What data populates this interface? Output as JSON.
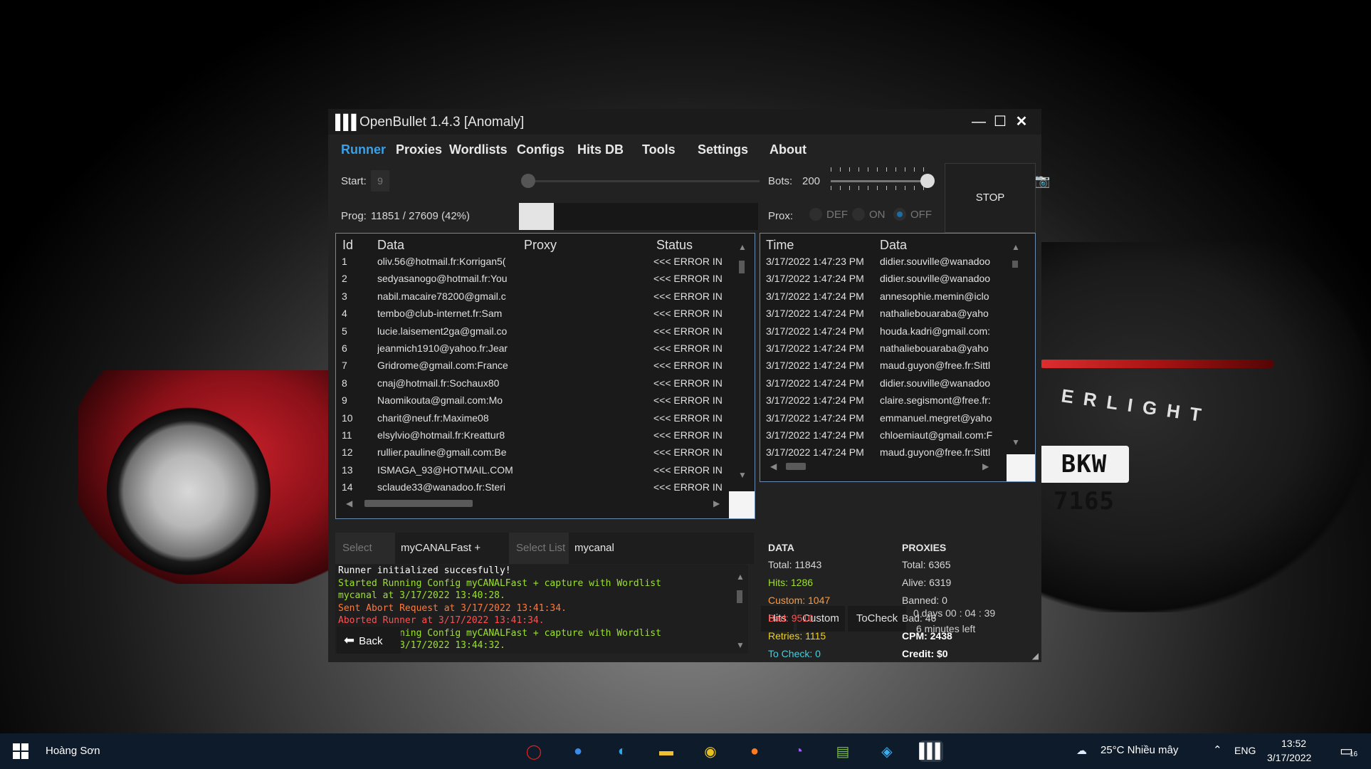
{
  "window": {
    "title": "OpenBullet 1.4.3 [Anomaly]",
    "controls": {
      "minimize": "—",
      "maximize": "☐",
      "close": "✕"
    }
  },
  "menu": [
    "Runner",
    "Proxies",
    "Wordlists",
    "Configs",
    "Hits DB",
    "Tools",
    "Settings",
    "About"
  ],
  "runner": {
    "start_label": "Start:",
    "start_value": "9",
    "prog_label": "Prog:",
    "prog_text": "11851 / 27609 (42%)",
    "progress_fraction": 0.42,
    "bots_label": "Bots:",
    "bots_value": "200",
    "prox_label": "Prox:",
    "prox_options": [
      "DEF",
      "ON",
      "OFF"
    ],
    "prox_selected": "OFF",
    "stop_label": "STOP"
  },
  "data_table": {
    "headers": [
      "Id",
      "Data",
      "Proxy",
      "Status"
    ],
    "rows": [
      [
        "1",
        "oliv.56@hotmail.fr:Korrigan5(",
        "",
        "<<< ERROR IN"
      ],
      [
        "2",
        "sedyasanogo@hotmail.fr:You",
        "",
        "<<< ERROR IN"
      ],
      [
        "3",
        "nabil.macaire78200@gmail.c",
        "",
        "<<< ERROR IN"
      ],
      [
        "4",
        "tembo@club-internet.fr:Sam",
        "",
        "<<< ERROR IN"
      ],
      [
        "5",
        "lucie.laisement2ga@gmail.co",
        "",
        "<<< ERROR IN"
      ],
      [
        "6",
        "jeanmich1910@yahoo.fr:Jear",
        "",
        "<<< ERROR IN"
      ],
      [
        "7",
        "Gridrome@gmail.com:France",
        "",
        "<<< ERROR IN"
      ],
      [
        "8",
        "cnaj@hotmail.fr:Sochaux80",
        "",
        "<<< ERROR IN"
      ],
      [
        "9",
        "Naomikouta@gmail.com:Mo",
        "",
        "<<< ERROR IN"
      ],
      [
        "10",
        "charit@neuf.fr:Maxime08",
        "",
        "<<< ERROR IN"
      ],
      [
        "11",
        "elsylvio@hotmail.fr:Kreattur8",
        "",
        "<<< ERROR IN"
      ],
      [
        "12",
        "rullier.pauline@gmail.com:Be",
        "",
        "<<< ERROR IN"
      ],
      [
        "13",
        "ISMAGA_93@HOTMAIL.COM",
        "",
        "<<< ERROR IN"
      ],
      [
        "14",
        "sclaude33@wanadoo.fr:Steri",
        "",
        "<<< ERROR IN"
      ]
    ]
  },
  "hits_table": {
    "headers": [
      "Time",
      "Data"
    ],
    "rows": [
      [
        "3/17/2022 1:47:23 PM",
        "didier.souville@wanadoo"
      ],
      [
        "3/17/2022 1:47:24 PM",
        "didier.souville@wanadoo"
      ],
      [
        "3/17/2022 1:47:24 PM",
        "annesophie.memin@iclo"
      ],
      [
        "3/17/2022 1:47:24 PM",
        "nathaliebouaraba@yaho"
      ],
      [
        "3/17/2022 1:47:24 PM",
        "houda.kadri@gmail.com:"
      ],
      [
        "3/17/2022 1:47:24 PM",
        "nathaliebouaraba@yaho"
      ],
      [
        "3/17/2022 1:47:24 PM",
        "maud.guyon@free.fr:Sittl"
      ],
      [
        "3/17/2022 1:47:24 PM",
        "didier.souville@wanadoo"
      ],
      [
        "3/17/2022 1:47:24 PM",
        "claire.segismont@free.fr:"
      ],
      [
        "3/17/2022 1:47:24 PM",
        "emmanuel.megret@yaho"
      ],
      [
        "3/17/2022 1:47:24 PM",
        "chloemiaut@gmail.com:F"
      ],
      [
        "3/17/2022 1:47:24 PM",
        "maud.guyon@free.fr:Sittl"
      ]
    ]
  },
  "hit_tabs": [
    "Hits",
    "Custom",
    "ToCheck"
  ],
  "time_left": {
    "elapsed": "0 days 00 : 04 : 39",
    "remaining": "6 minutes left"
  },
  "select": {
    "cfg_label": "Select CFG",
    "cfg_value": "myCANALFast + capture",
    "list_label": "Select List",
    "list_value": "mycanal"
  },
  "log": [
    {
      "text": "Runner initialized succesfully!",
      "color": "#ffffff"
    },
    {
      "text": "Started Running Config myCANALFast + capture with Wordlist",
      "color": "#9be22d"
    },
    {
      "text": "mycanal at 3/17/2022 13:40:28.",
      "color": "#9be22d"
    },
    {
      "text": "Sent Abort Request at 3/17/2022 13:41:34.",
      "color": "#ff7a3c"
    },
    {
      "text": "Aborted Runner at 3/17/2022 13:41:34.",
      "color": "#ff5050"
    },
    {
      "text": "Started Running Config myCANALFast + capture with Wordlist",
      "color": "#9be22d"
    },
    {
      "text": "mycanal at 3/17/2022 13:44:32.",
      "color": "#9be22d"
    }
  ],
  "back_label": "Back",
  "data_stats": {
    "heading": "DATA",
    "total_label": "Total:",
    "total": "11843",
    "hits_label": "Hits:",
    "hits": "1286",
    "custom_label": "Custom:",
    "custom": "1047",
    "bad_label": "Bad:",
    "bad": "9510",
    "retries_label": "Retries:",
    "retries": "1115",
    "tocheck_label": "To Check:",
    "tocheck": "0"
  },
  "proxy_stats": {
    "heading": "PROXIES",
    "total_label": "Total:",
    "total": "6365",
    "alive_label": "Alive:",
    "alive": "6319",
    "banned_label": "Banned:",
    "banned": "0",
    "bad_label": "Bad:",
    "bad": "46",
    "cpm_label": "CPM:",
    "cpm": "2438",
    "credit_label": "Credit:",
    "credit": "$0"
  },
  "colors": {
    "accent": "#3aa0e8",
    "hits": "#9be22d",
    "custom": "#ff9a3c",
    "bad": "#ff5050",
    "retries": "#f0d020",
    "tocheck": "#40d0e0"
  },
  "background": {
    "license_plate": "BKW 7165",
    "car_badge": "ERLIGHT"
  },
  "taskbar": {
    "user": "Hoàng Sơn",
    "apps": [
      "opera-icon",
      "firefox-dev-icon",
      "edge-icon",
      "file-explorer-icon",
      "chrome-icon",
      "firefox-icon",
      "messenger-icon",
      "notepad-icon",
      "shield-app-icon",
      "openbullet-icon"
    ],
    "weather": "25°C  Nhiều mây",
    "lang": "ENG",
    "time": "13:52",
    "date": "3/17/2022",
    "notifications": "16"
  }
}
